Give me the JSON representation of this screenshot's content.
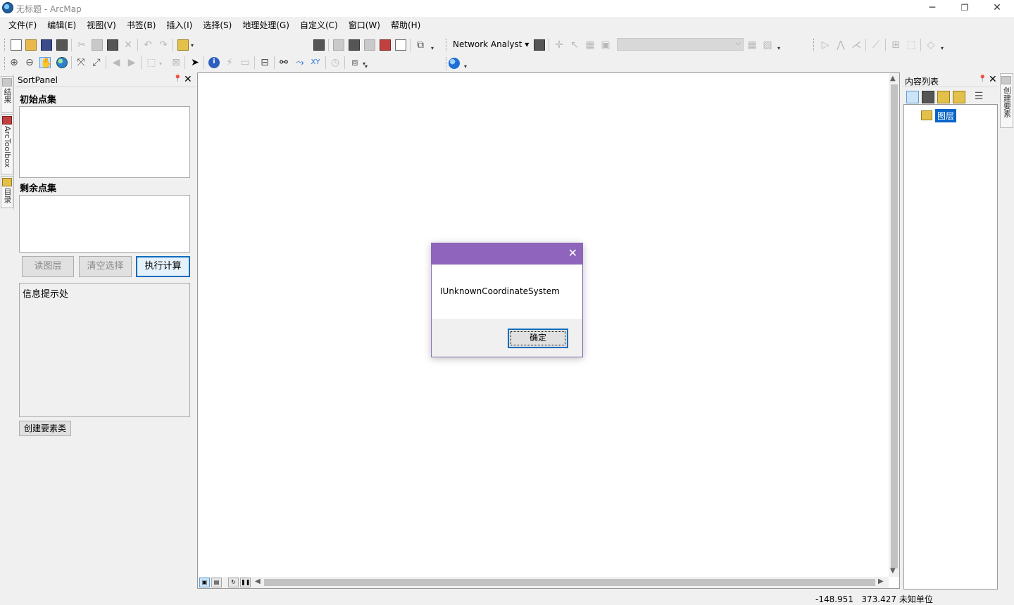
{
  "window": {
    "title": "无标题 - ArcMap",
    "minimize": "─",
    "restore": "❐",
    "close": "✕"
  },
  "menu": [
    "文件(F)",
    "编辑(E)",
    "视图(V)",
    "书签(B)",
    "插入(I)",
    "选择(S)",
    "地理处理(G)",
    "自定义(C)",
    "窗口(W)",
    "帮助(H)"
  ],
  "toolbar": {
    "network_analyst": "Network Analyst ▾"
  },
  "left_tabs": {
    "results": "结果",
    "arctoolbox": "ArcToolbox",
    "catalog": "目录"
  },
  "sort_panel": {
    "title": "SortPanel",
    "initial_points_label": "初始点集",
    "remaining_points_label": "剩余点集",
    "read_layer_button": "读图层",
    "clear_selection_button": "清空选择",
    "execute_button": "执行计算",
    "info_text": "信息提示处",
    "create_feature_class_button": "创建要素类",
    "pin": "📌",
    "close": "✕"
  },
  "toc": {
    "title": "内容列表",
    "layer_name": "图层",
    "pin": "📌",
    "close": "✕"
  },
  "right_tab": {
    "create_features": "创建要素"
  },
  "status": {
    "x": "-148.951",
    "y": "373.427",
    "units": "未知单位"
  },
  "dialog": {
    "message": "IUnknownCoordinateSystem",
    "ok_button": "确定",
    "close": "✕"
  },
  "colors": {
    "dialog_title": "#8e64bd",
    "selection": "#0a64c8",
    "accent": "#0f6cbd"
  }
}
